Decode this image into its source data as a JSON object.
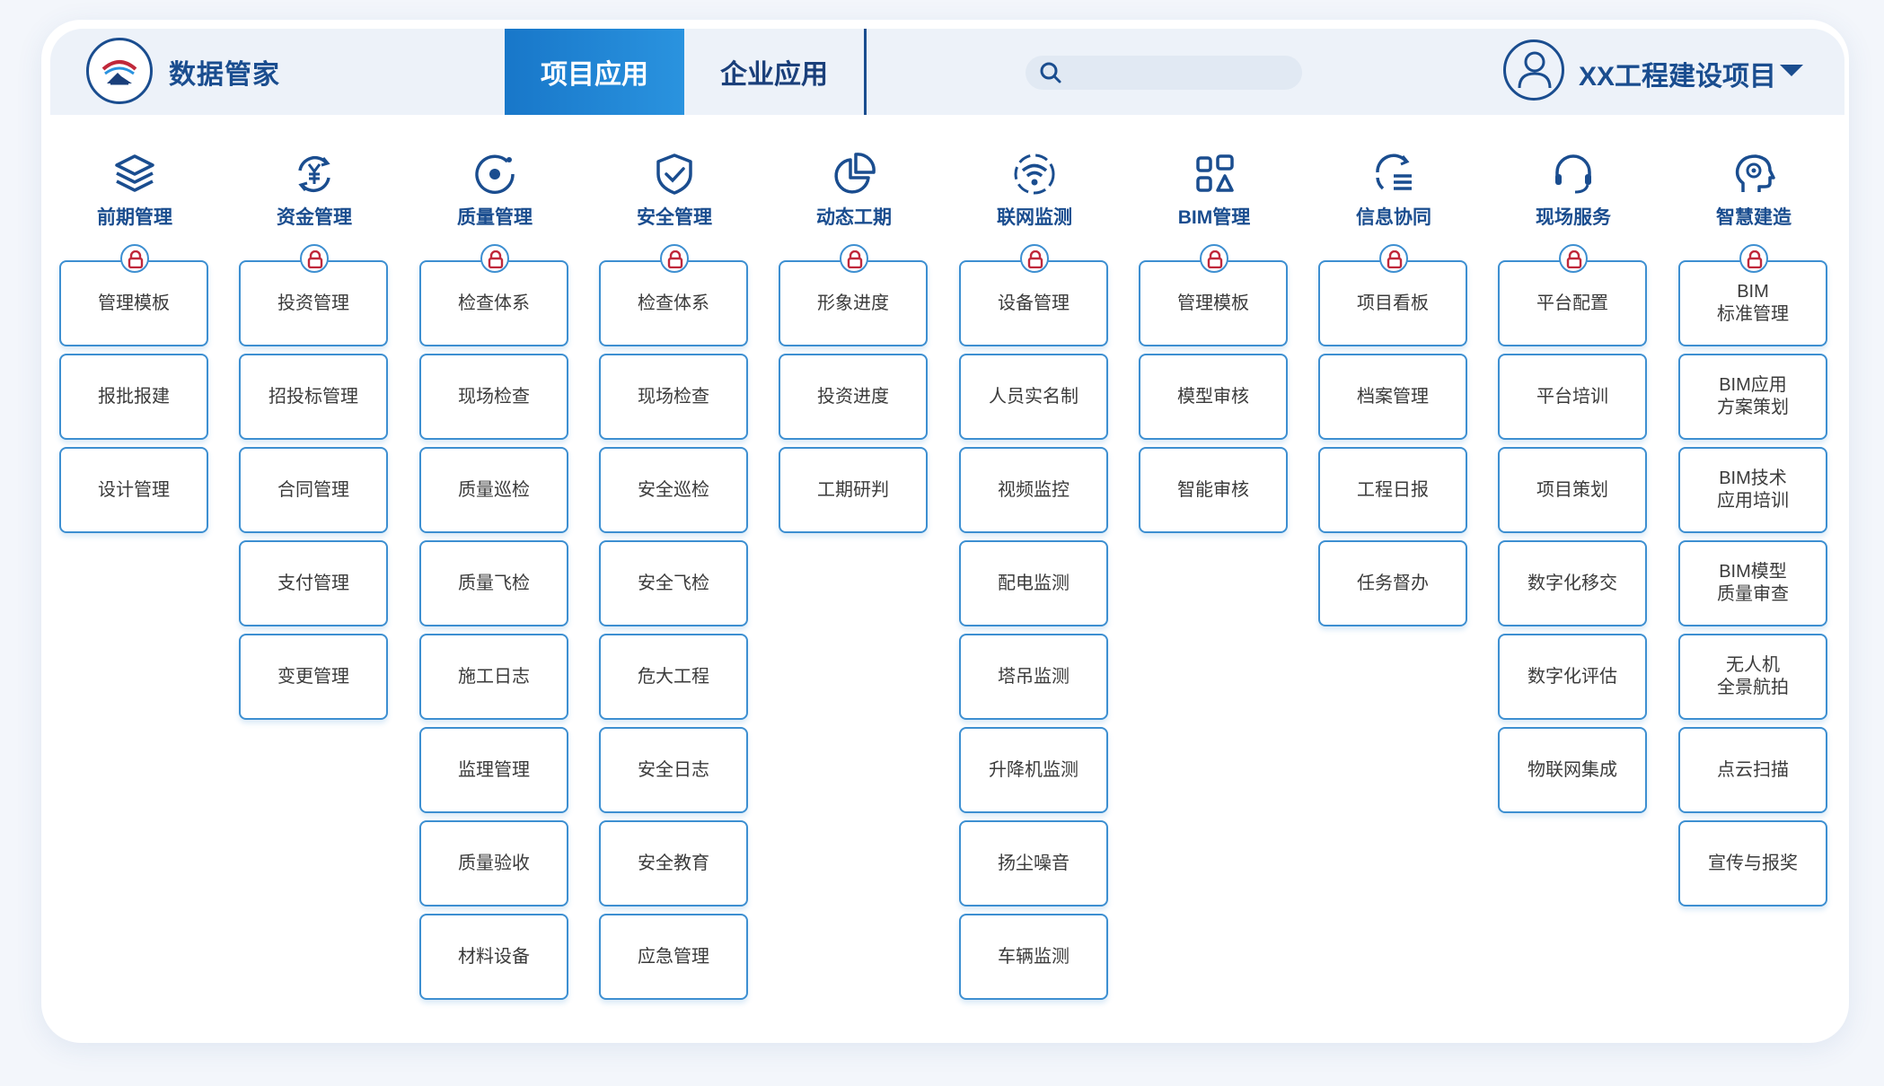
{
  "brand": {
    "name": "数据管家",
    "logo_icon": "cloud-logo-icon"
  },
  "tabs": [
    {
      "label": "项目应用",
      "active": true
    },
    {
      "label": "企业应用",
      "active": false
    }
  ],
  "search": {
    "placeholder": "",
    "value": ""
  },
  "user": {
    "project": "XX工程建设项目",
    "avatar_icon": "user-icon"
  },
  "colors": {
    "primary": "#1a4d8f",
    "accent": "#2a93df",
    "border": "#3d8fd1",
    "lock": "#c0283a"
  },
  "columns": [
    {
      "title": "前期管理",
      "icon": "layers-icon",
      "items": [
        "管理模板",
        "报批报建",
        "设计管理"
      ]
    },
    {
      "title": "资金管理",
      "icon": "yuan-cycle-icon",
      "items": [
        "投资管理",
        "招投标管理",
        "合同管理",
        "支付管理",
        "变更管理"
      ]
    },
    {
      "title": "质量管理",
      "icon": "target-icon",
      "items": [
        "检查体系",
        "现场检查",
        "质量巡检",
        "质量飞检",
        "施工日志",
        "监理管理",
        "质量验收",
        "材料设备"
      ]
    },
    {
      "title": "安全管理",
      "icon": "shield-check-icon",
      "items": [
        "检查体系",
        "现场检查",
        "安全巡检",
        "安全飞检",
        "危大工程",
        "安全日志",
        "安全教育",
        "应急管理"
      ]
    },
    {
      "title": "动态工期",
      "icon": "pie-chart-icon",
      "items": [
        "形象进度",
        "投资进度",
        "工期研判"
      ]
    },
    {
      "title": "联网监测",
      "icon": "wifi-icon",
      "items": [
        "设备管理",
        "人员实名制",
        "视频监控",
        "配电监测",
        "塔吊监测",
        "升降机监测",
        "扬尘噪音",
        "车辆监测"
      ]
    },
    {
      "title": "BIM管理",
      "icon": "blocks-icon",
      "items": [
        "管理模板",
        "模型审核",
        "智能审核"
      ]
    },
    {
      "title": "信息协同",
      "icon": "sync-list-icon",
      "items": [
        "项目看板",
        "档案管理",
        "工程日报",
        "任务督办"
      ]
    },
    {
      "title": "现场服务",
      "icon": "headset-icon",
      "items": [
        "平台配置",
        "平台培训",
        "项目策划",
        "数字化移交",
        "数字化评估",
        "物联网集成"
      ]
    },
    {
      "title": "智慧建造",
      "icon": "brain-gear-icon",
      "items": [
        "BIM\n标准管理",
        "BIM应用\n方案策划",
        "BIM技术\n应用培训",
        "BIM模型\n质量审查",
        "无人机\n全景航拍",
        "点云扫描",
        "宣传与报奖"
      ]
    }
  ]
}
